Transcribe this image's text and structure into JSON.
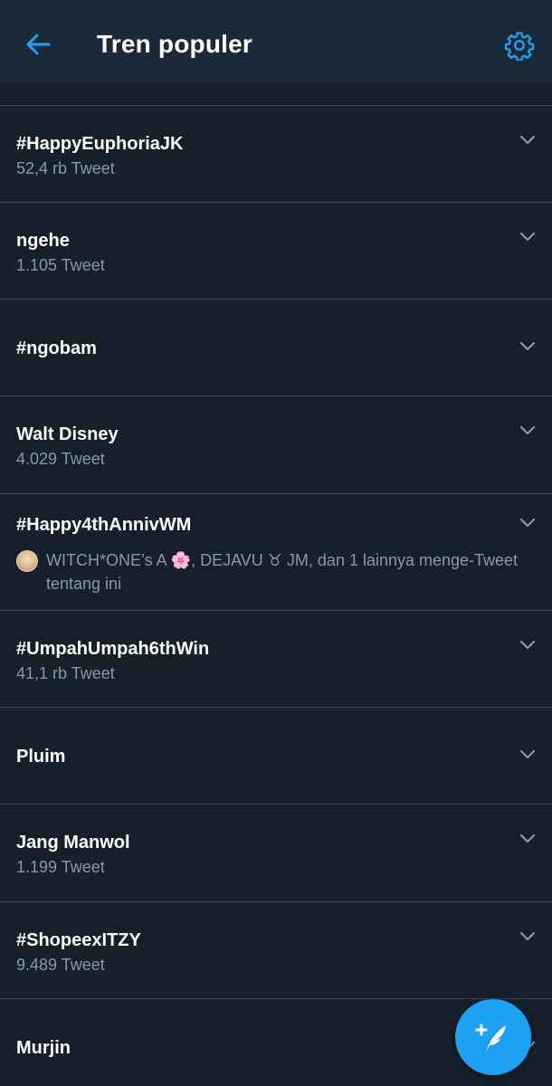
{
  "header": {
    "title": "Tren populer",
    "back_icon": "arrow-left-icon",
    "settings_icon": "gear-icon",
    "accent_color": "#1da1f2"
  },
  "trends": [
    {
      "name": "#HappyEuphoriaJK",
      "count": "52,4 rb Tweet"
    },
    {
      "name": "ngehe",
      "count": "1.105 Tweet"
    },
    {
      "name": "#ngobam",
      "count": ""
    },
    {
      "name": "Walt Disney",
      "count": "4.029 Tweet"
    },
    {
      "name": "#Happy4thAnnivWM",
      "count": "",
      "social_context": "WITCH*ONE’s A 🌸, DEJAVU ♉ JM, dan 1 lainnya menge-Tweet tentang ini"
    },
    {
      "name": "#UmpahUmpah6thWin",
      "count": "41,1 rb Tweet"
    },
    {
      "name": "Pluim",
      "count": ""
    },
    {
      "name": "Jang Manwol",
      "count": "1.199 Tweet"
    },
    {
      "name": "#ShopeexITZY",
      "count": "9.489 Tweet"
    },
    {
      "name": "Murjin",
      "count": ""
    }
  ],
  "fab": {
    "icon": "compose-tweet-icon"
  }
}
